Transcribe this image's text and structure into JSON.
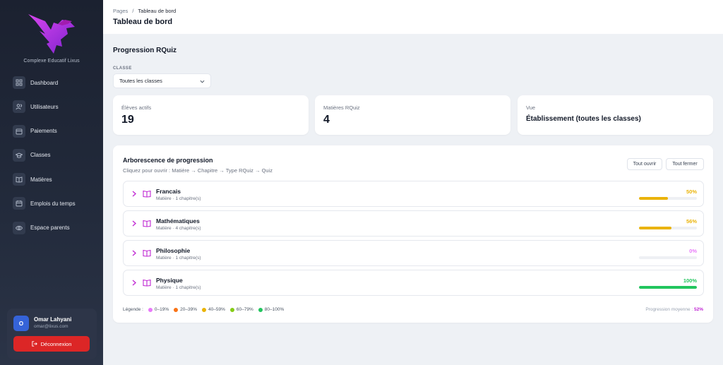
{
  "sidebar": {
    "school": "Complexe Educatif Lixus",
    "items": [
      {
        "label": "Dashboard",
        "icon": "grid-icon"
      },
      {
        "label": "Utilisateurs",
        "icon": "users-icon"
      },
      {
        "label": "Paiements",
        "icon": "wallet-icon"
      },
      {
        "label": "Classes",
        "icon": "graduation-cap-icon"
      },
      {
        "label": "Matières",
        "icon": "book-icon"
      },
      {
        "label": "Emplois du temps",
        "icon": "calendar-icon"
      },
      {
        "label": "Espace parents",
        "icon": "eye-icon"
      }
    ],
    "user": {
      "initial": "O",
      "name": "Omar Lahyani",
      "email": "omar@lixus.com"
    },
    "logout_label": "Déconnexion"
  },
  "header": {
    "breadcrumb_root": "Pages",
    "breadcrumb_sep": "/",
    "breadcrumb_current": "Tableau de bord",
    "title": "Tableau de bord"
  },
  "main": {
    "section_title": "Progression RQuiz",
    "class_label": "CLASSE",
    "class_select_value": "Toutes les classes",
    "stats": [
      {
        "label": "Élèves actifs",
        "value": "19"
      },
      {
        "label": "Matières RQuiz",
        "value": "4"
      },
      {
        "label": "Vue",
        "value": "Établissement (toutes les classes)"
      }
    ],
    "tree": {
      "title": "Arborescence de progression",
      "subtitle": "Cliquez pour ouvrir : Matière → Chapitre → Type RQuiz → Quiz",
      "open_all": "Tout ouvrir",
      "close_all": "Tout fermer",
      "rows": [
        {
          "subject": "Francais",
          "meta": "Matière · 1 chapitre(s)",
          "percent_label": "50%",
          "progress": 0.5,
          "color": "#eab308"
        },
        {
          "subject": "Mathématiques",
          "meta": "Matière · 4 chapitre(s)",
          "percent_label": "56%",
          "progress": 0.56,
          "color": "#eab308"
        },
        {
          "subject": "Philosophie",
          "meta": "Matière · 1 chapitre(s)",
          "percent_label": "0%",
          "progress": 0.0,
          "color": "#e879f9"
        },
        {
          "subject": "Physique",
          "meta": "Matière · 1 chapitre(s)",
          "percent_label": "100%",
          "progress": 1.0,
          "color": "#22c55e"
        }
      ],
      "legend_title": "Légende :",
      "legend": [
        {
          "label": "0–19%",
          "color": "#e879f9"
        },
        {
          "label": "20–39%",
          "color": "#f97316"
        },
        {
          "label": "40–59%",
          "color": "#eab308"
        },
        {
          "label": "60–79%",
          "color": "#84cc16"
        },
        {
          "label": "80–100%",
          "color": "#22c55e"
        }
      ],
      "average_label": "Progression moyenne :",
      "average_value": "52%"
    }
  },
  "colors": {
    "accent": "#c026d3",
    "danger": "#dc2626",
    "sidebar": "#1b2130"
  }
}
